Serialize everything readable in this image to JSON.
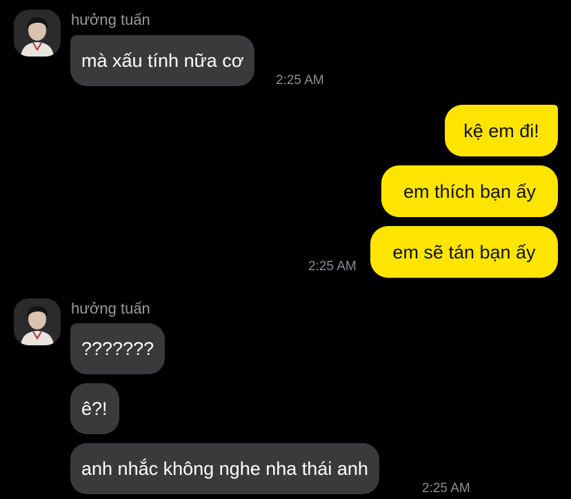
{
  "messages": [
    {
      "sender": "hưởng tuấn",
      "avatar_icon": "profile-photo-avatar",
      "bubbles": [
        "mà xấu tính nữa cơ"
      ],
      "time": "2:25 AM"
    },
    {
      "sender": "",
      "bubbles": [
        "kệ em đi!",
        "em thích bạn ấy",
        "em sẽ tán bạn ấy"
      ],
      "time": "2:25 AM"
    },
    {
      "sender": "hưởng tuấn",
      "avatar_icon": "profile-photo-avatar",
      "bubbles": [
        "???????",
        "ê?!",
        "anh nhắc không nghe nha thái anh"
      ],
      "time": "2:25 AM"
    }
  ],
  "colors": {
    "background": "#000000",
    "incoming_bubble": "#3a3a3c",
    "outgoing_bubble": "#fee500",
    "timestamp": "#8e8e93"
  }
}
